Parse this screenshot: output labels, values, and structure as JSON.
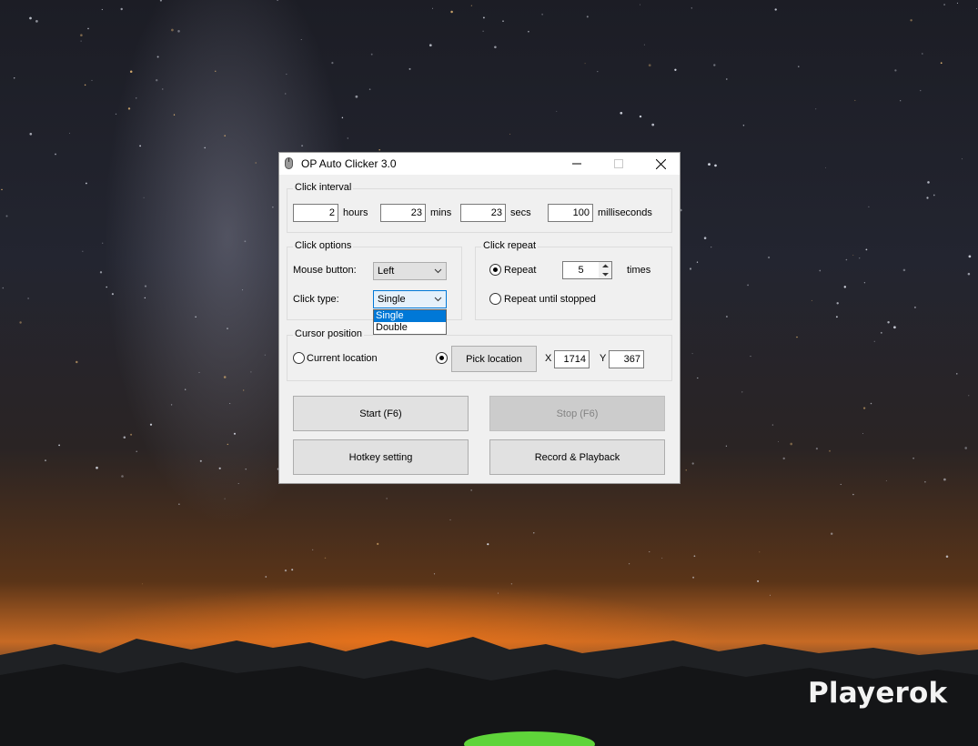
{
  "window": {
    "title": "OP Auto Clicker 3.0",
    "icon": "mouse-icon",
    "controls": [
      "minimize-icon",
      "maximize-icon",
      "close-icon"
    ]
  },
  "click_interval": {
    "label": "Click interval",
    "hours_value": "2",
    "hours_label": "hours",
    "mins_value": "23",
    "mins_label": "mins",
    "secs_value": "23",
    "secs_label": "secs",
    "ms_value": "100",
    "ms_label": "milliseconds"
  },
  "click_options": {
    "label": "Click options",
    "mouse_button_label": "Mouse button:",
    "mouse_button_value": "Left",
    "click_type_label": "Click type:",
    "click_type_value": "Single",
    "click_type_options": [
      "Single",
      "Double"
    ]
  },
  "click_repeat": {
    "label": "Click repeat",
    "repeat_label": "Repeat",
    "repeat_value": "5",
    "times_label": "times",
    "until_stopped_label": "Repeat until stopped",
    "selected": "repeat"
  },
  "cursor_position": {
    "label": "Cursor position",
    "current_location_label": "Current location",
    "pick_location_label": "Pick location",
    "x_label": "X",
    "x_value": "1714",
    "y_label": "Y",
    "y_value": "367",
    "selected": "pick"
  },
  "buttons": {
    "start": "Start (F6)",
    "stop": "Stop (F6)",
    "hotkey": "Hotkey setting",
    "record": "Record & Playback"
  },
  "watermark": "Playerok",
  "colors": {
    "accent": "#0078d7",
    "window_bg": "#f0f0f0",
    "button_bg": "#e1e1e1",
    "button_disabled_bg": "#cccccc"
  }
}
